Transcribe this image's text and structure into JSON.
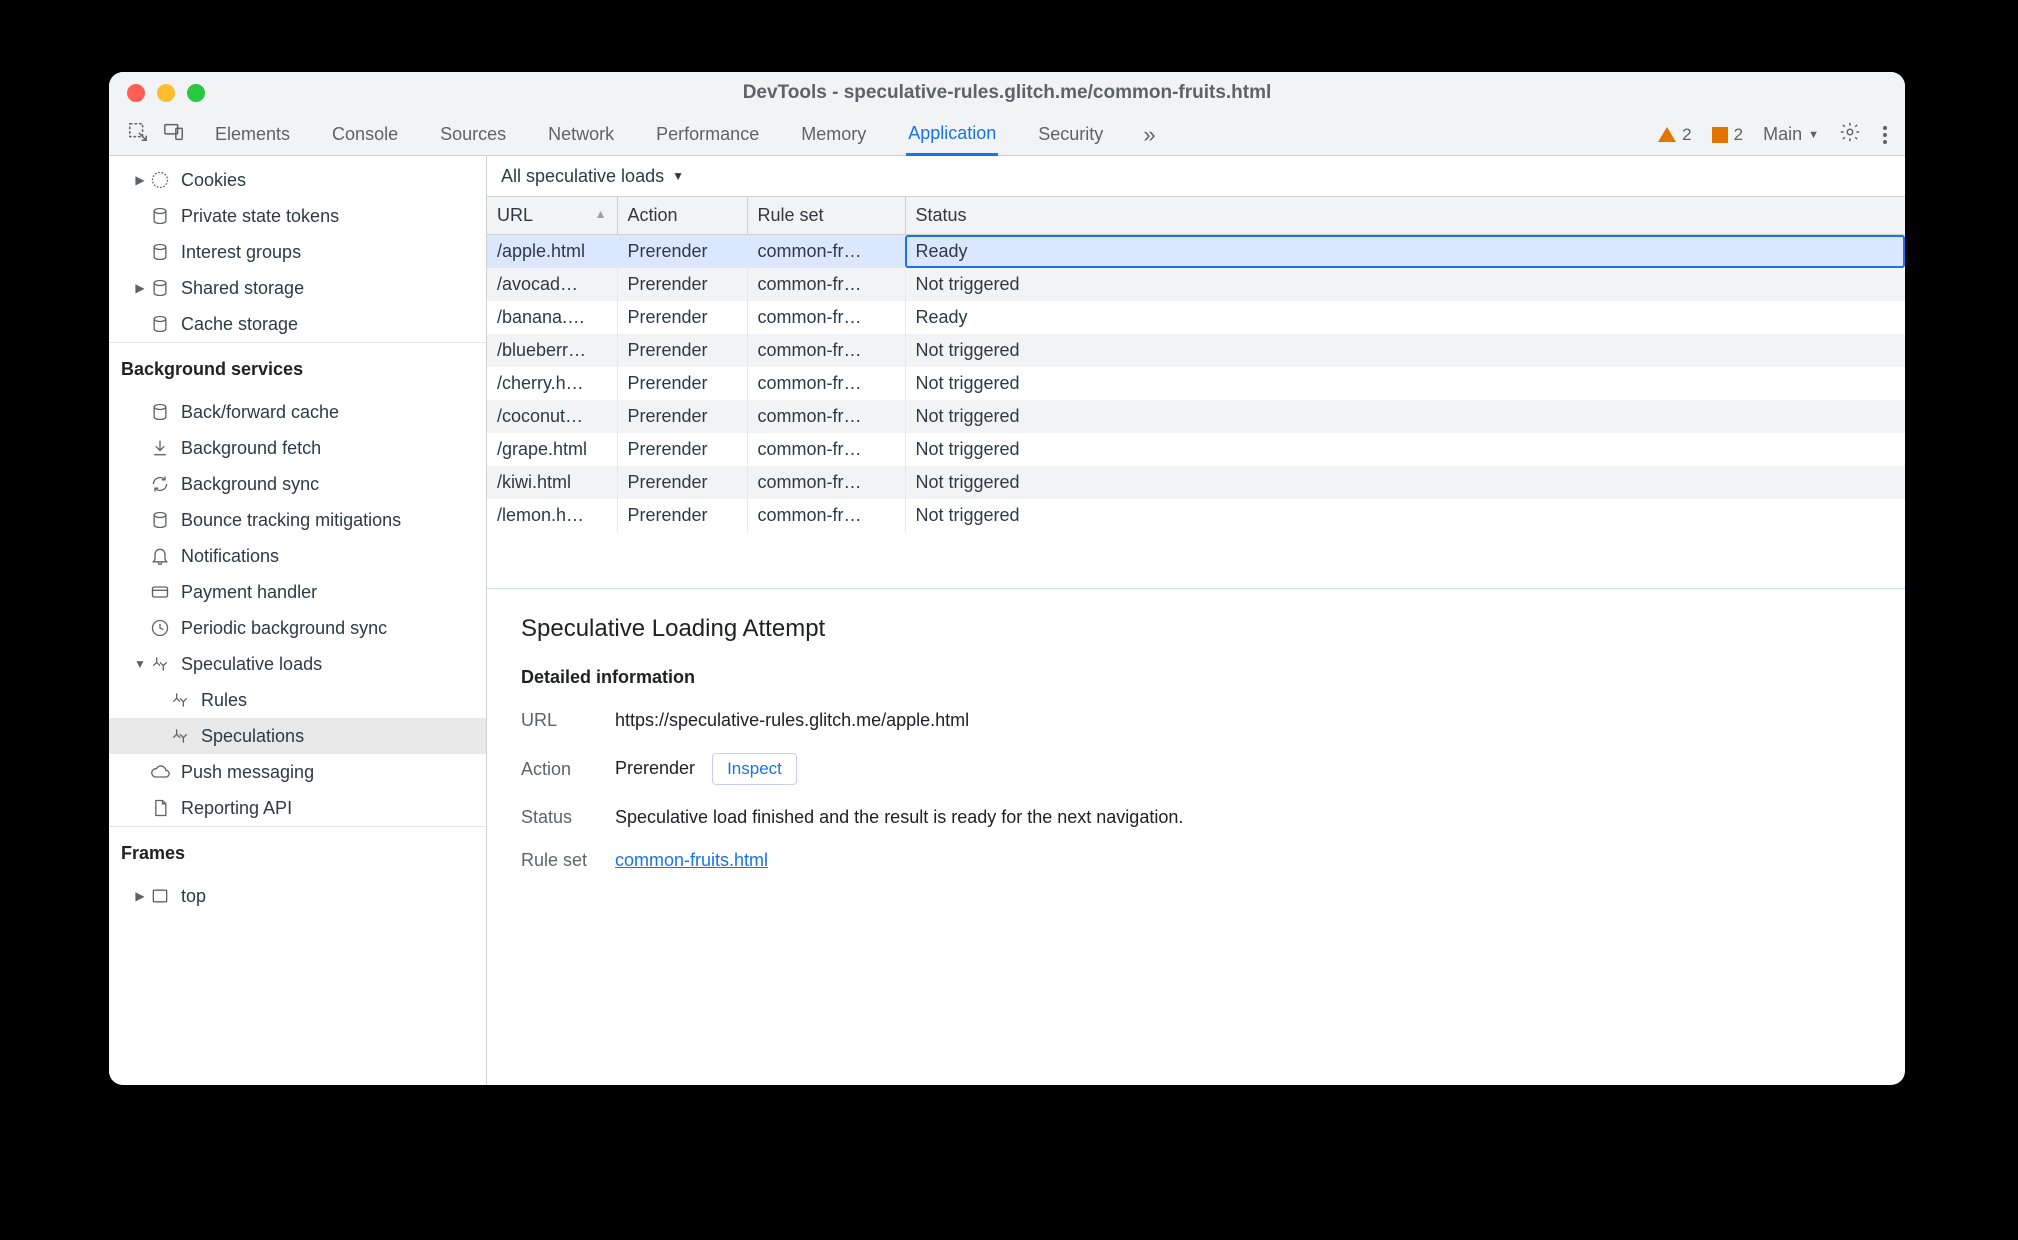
{
  "window_title": "DevTools - speculative-rules.glitch.me/common-fruits.html",
  "tabs": {
    "elements": "Elements",
    "console": "Console",
    "sources": "Sources",
    "network": "Network",
    "performance": "Performance",
    "memory": "Memory",
    "application": "Application",
    "security": "Security"
  },
  "warnings_count": "2",
  "issues_count": "2",
  "target_label": "Main",
  "sidebar": {
    "cookies": "Cookies",
    "private_state_tokens": "Private state tokens",
    "interest_groups": "Interest groups",
    "shared_storage": "Shared storage",
    "cache_storage": "Cache storage",
    "section_bg": "Background services",
    "bf_cache": "Back/forward cache",
    "bg_fetch": "Background fetch",
    "bg_sync": "Background sync",
    "bounce": "Bounce tracking mitigations",
    "notifications": "Notifications",
    "payment": "Payment handler",
    "periodic": "Periodic background sync",
    "spec_loads": "Speculative loads",
    "rules": "Rules",
    "speculations": "Speculations",
    "push": "Push messaging",
    "reporting": "Reporting API",
    "section_frames": "Frames",
    "top_frame": "top"
  },
  "filter_label": "All speculative loads",
  "columns": {
    "url": "URL",
    "action": "Action",
    "ruleset": "Rule set",
    "status": "Status"
  },
  "rows": [
    {
      "url": "/apple.html",
      "action": "Prerender",
      "ruleset": "common-fr…",
      "status": "Ready",
      "selected": true
    },
    {
      "url": "/avocad…",
      "action": "Prerender",
      "ruleset": "common-fr…",
      "status": "Not triggered"
    },
    {
      "url": "/banana.…",
      "action": "Prerender",
      "ruleset": "common-fr…",
      "status": "Ready"
    },
    {
      "url": "/blueberr…",
      "action": "Prerender",
      "ruleset": "common-fr…",
      "status": "Not triggered"
    },
    {
      "url": "/cherry.h…",
      "action": "Prerender",
      "ruleset": "common-fr…",
      "status": "Not triggered"
    },
    {
      "url": "/coconut…",
      "action": "Prerender",
      "ruleset": "common-fr…",
      "status": "Not triggered"
    },
    {
      "url": "/grape.html",
      "action": "Prerender",
      "ruleset": "common-fr…",
      "status": "Not triggered"
    },
    {
      "url": "/kiwi.html",
      "action": "Prerender",
      "ruleset": "common-fr…",
      "status": "Not triggered"
    },
    {
      "url": "/lemon.h…",
      "action": "Prerender",
      "ruleset": "common-fr…",
      "status": "Not triggered"
    }
  ],
  "detail": {
    "heading": "Speculative Loading Attempt",
    "subheading": "Detailed information",
    "url_label": "URL",
    "url_value": "https://speculative-rules.glitch.me/apple.html",
    "action_label": "Action",
    "action_value": "Prerender",
    "inspect": "Inspect",
    "status_label": "Status",
    "status_value": "Speculative load finished and the result is ready for the next navigation.",
    "ruleset_label": "Rule set",
    "ruleset_value": "common-fruits.html"
  }
}
